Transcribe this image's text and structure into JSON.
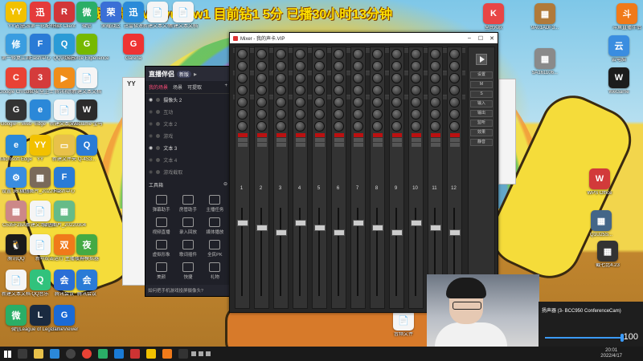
{
  "banner": {
    "text": "我的微信V：yujipw1 目前钻1 5分 已播30小时13分钟"
  },
  "desktop_icons": [
    {
      "label": "YY语音",
      "color": "#f2c100",
      "glyph": "YY"
    },
    {
      "label": "迅游第一轮配有限",
      "color": "#e43b3b",
      "glyph": "迅"
    },
    {
      "label": "Riot Client",
      "color": "#d13639",
      "glyph": "R"
    },
    {
      "label": "微信",
      "color": "#2aae67",
      "glyph": "微"
    },
    {
      "label": "荣耀战区",
      "color": "#3a6fd6",
      "glyph": "荣"
    },
    {
      "label": "迅雷极速",
      "color": "#2a8ad8",
      "glyph": "迅"
    },
    {
      "label": "新建文本文档",
      "color": "#f5f5f5",
      "glyph": "📄"
    },
    {
      "label": "新建文本文档",
      "color": "#f5f5f5",
      "glyph": "📄"
    },
    {
      "label": "全民K歌",
      "color": "#e84545",
      "glyph": "K"
    },
    {
      "label": "9A01ADF3...",
      "color": "#b07a3a",
      "glyph": "▦"
    },
    {
      "label": "斗鱼直播伴侣",
      "color": "#f07a1a",
      "glyph": "斗"
    },
    {
      "label": "第一修复工具",
      "color": "#3a9de0",
      "glyph": "修"
    },
    {
      "label": "Flash中心",
      "color": "#2a7bd6",
      "glyph": "F"
    },
    {
      "label": "QQ浏览器",
      "color": "#2a9bd6",
      "glyph": "Q"
    },
    {
      "label": "GeForce Experience",
      "color": "#76b900",
      "glyph": "G"
    },
    {
      "label": "Garena",
      "color": "#e33",
      "glyph": "G"
    },
    {
      "label": "5A161106...",
      "color": "#8a8a8a",
      "glyph": "▦"
    },
    {
      "label": "云电脑",
      "color": "#3a8de0",
      "glyph": "云"
    },
    {
      "label": "Google Chrome",
      "color": "#e94235",
      "glyph": "C"
    },
    {
      "label": "360安全卫士",
      "color": "#d43b3b",
      "glyph": "3"
    },
    {
      "label": "腾讯视频",
      "color": "#f08d1a",
      "glyph": "▶"
    },
    {
      "label": "新建文本文档",
      "color": "#f5f5f5",
      "glyph": "📄"
    },
    {
      "label": "WeGame",
      "color": "#1c1c1c",
      "glyph": "W"
    },
    {
      "label": "Google-...Web",
      "color": "#333",
      "glyph": "G"
    },
    {
      "label": "Edge",
      "color": "#2b88d8",
      "glyph": "e"
    },
    {
      "label": "新建文本文档",
      "color": "#f5f5f5",
      "glyph": "📄"
    },
    {
      "label": "WeGame 宝马",
      "color": "#2b2b2b",
      "glyph": "W"
    },
    {
      "label": "Microsoft Edge",
      "color": "#2b88d8",
      "glyph": "e"
    },
    {
      "label": "YY",
      "color": "#f2c100",
      "glyph": "YY"
    },
    {
      "label": "新建文件夹",
      "color": "#e8c14a",
      "glyph": "▭"
    },
    {
      "label": "Q-4S3...",
      "color": "#2a7bd6",
      "glyph": "Q"
    },
    {
      "label": "设置 360文档",
      "color": "#3a8de0",
      "glyph": "⚙"
    },
    {
      "label": "微信图片_2022040",
      "color": "#7a6a5a",
      "glyph": "▦"
    },
    {
      "label": "Flash中心",
      "color": "#2a7bd6",
      "glyph": "F"
    },
    {
      "label": "WPS Office",
      "color": "#d23a3a",
      "glyph": "W"
    },
    {
      "label": "C535F28A...",
      "color": "#c88",
      "glyph": "▦"
    },
    {
      "label": "新建文本文档",
      "color": "#f5f5f5",
      "glyph": "📄"
    },
    {
      "label": "微信图片_20220304",
      "color": "#6b8",
      "glyph": "▦"
    },
    {
      "label": "Q1U25S...",
      "color": "#468",
      "glyph": "▦"
    },
    {
      "label": "腾讯QQ",
      "color": "#1a1a1a",
      "glyph": "🐧"
    },
    {
      "label": "新年",
      "color": "#f5f5f5",
      "glyph": "📄"
    },
    {
      "label": "双击运行 主播专用",
      "color": "#f07a1a",
      "glyph": "双"
    },
    {
      "label": "夜神模拟器",
      "color": "#4a4",
      "glyph": "夜"
    },
    {
      "label": "腾讯会议",
      "color": "#2a6fd6",
      "glyph": "会"
    },
    {
      "label": "新建文本文档",
      "color": "#f5f5f5",
      "glyph": "📄"
    },
    {
      "label": "QQ音乐",
      "color": "#31c27c",
      "glyph": "Q"
    },
    {
      "label": "腾讯会议",
      "color": "#2a7bd6",
      "glyph": "会"
    },
    {
      "label": "截七比4.23",
      "color": "#333",
      "glyph": "▦"
    },
    {
      "label": "微信",
      "color": "#2aae67",
      "glyph": "微"
    },
    {
      "label": "League of Legends",
      "color": "#1a2a40",
      "glyph": "L"
    },
    {
      "label": "GameViewer",
      "color": "#1a6ad6",
      "glyph": "G"
    },
    {
      "label": "音频文件",
      "color": "#f5f5f5",
      "glyph": "📄"
    }
  ],
  "companion": {
    "title": "直播伴侣",
    "badge": "新版",
    "tabs": [
      "我的场景",
      "场景",
      "可提取"
    ],
    "layers": [
      "摄像头 2",
      "互动",
      "文本 2",
      "游戏",
      "文本 3",
      "文本 4",
      "游戏截取"
    ],
    "tools_label": "工具箱",
    "tools": [
      "弹幕助手",
      "房管助手",
      "主播任务",
      "视频直播",
      "录入回放",
      "媒体播放",
      "虚拟形象",
      "歌词插件",
      "全民PK",
      "美颜",
      "快捷",
      "礼物"
    ],
    "footer": "如何把手机游戏投屏摄像头?"
  },
  "white_window_title": "YY",
  "mixer": {
    "title": "Mixer - 我的声卡.VIP",
    "channels": [
      "1",
      "2",
      "3",
      "4",
      "5",
      "6",
      "7",
      "8",
      "9",
      "10",
      "11",
      "12"
    ],
    "right_buttons": [
      "设置",
      "M",
      "S",
      "输入",
      "输出",
      "监听",
      "效果",
      "静音"
    ]
  },
  "volume": {
    "device": "扬声器 (3- BCC950 ConferenceCam)",
    "value": "100"
  },
  "taskbar": {
    "time": "20:01",
    "date": "2022/4/17"
  }
}
